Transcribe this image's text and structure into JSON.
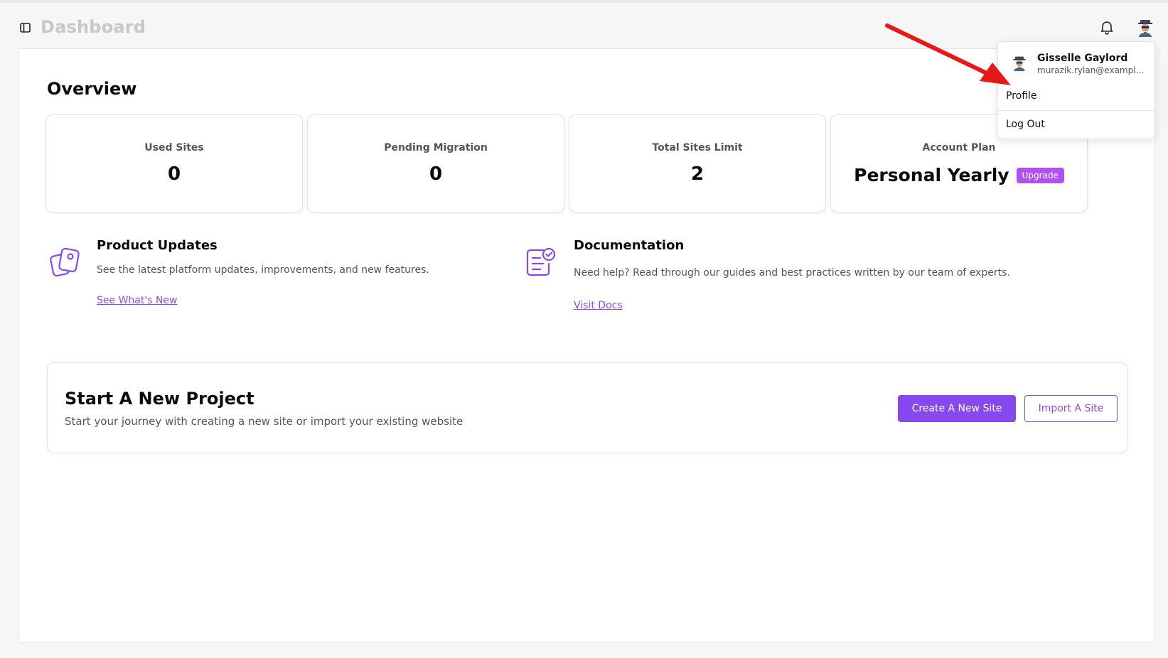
{
  "header": {
    "title": "Dashboard"
  },
  "overview": {
    "title": "Overview",
    "stats": [
      {
        "label": "Used Sites",
        "value": "0"
      },
      {
        "label": "Pending Migration",
        "value": "0"
      },
      {
        "label": "Total Sites Limit",
        "value": "2"
      }
    ],
    "plan": {
      "label": "Account Plan",
      "value": "Personal Yearly",
      "badge": "Upgrade"
    }
  },
  "product_updates": {
    "title": "Product Updates",
    "description": "See the latest platform updates, improvements, and new features.",
    "link": "See What's New"
  },
  "documentation": {
    "title": "Documentation",
    "description": "Need help? Read through our guides and best practices written by our team of experts.",
    "link": "Visit Docs"
  },
  "project": {
    "title": "Start A New Project",
    "subtitle": "Start your journey with creating a new site or import your existing website",
    "create_label": "Create A New Site",
    "import_label": "Import A Site"
  },
  "user_menu": {
    "name": "Gisselle Gaylord",
    "email": "murazik.rylan@exampl...",
    "items": [
      {
        "label": "Profile"
      },
      {
        "label": "Log Out"
      }
    ]
  },
  "colors": {
    "accent": "#8848f0",
    "badge": "#b050f0",
    "annotation_arrow": "#e81818"
  }
}
